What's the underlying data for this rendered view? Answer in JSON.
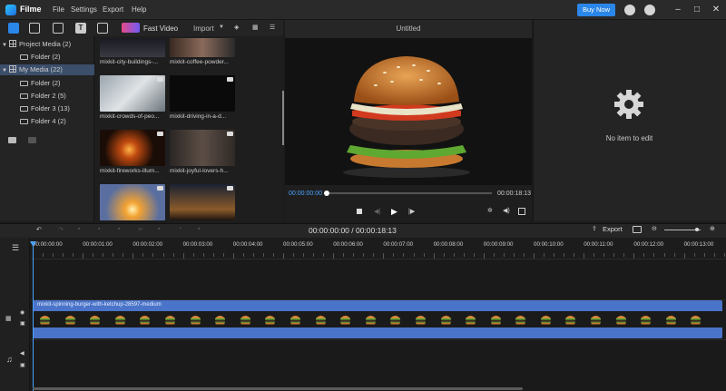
{
  "app": {
    "name": "Filme"
  },
  "menu": [
    "File",
    "Settings",
    "Export",
    "Help"
  ],
  "buy_now": "Buy Now",
  "left_toolbar": {
    "fast_video": "Fast Video",
    "import": "Import"
  },
  "tree": [
    {
      "label": "Project Media (2)",
      "level": 0,
      "selected": false
    },
    {
      "label": "Folder (2)",
      "level": 1,
      "selected": false
    },
    {
      "label": "My Media (22)",
      "level": 0,
      "selected": true
    },
    {
      "label": "Folder (2)",
      "level": 1,
      "selected": false
    },
    {
      "label": "Folder 2 (5)",
      "level": 1,
      "selected": false
    },
    {
      "label": "Folder 3 (13)",
      "level": 1,
      "selected": false
    },
    {
      "label": "Folder 4 (2)",
      "level": 1,
      "selected": false
    }
  ],
  "media": [
    {
      "label": "mixkit-city-buildings-..."
    },
    {
      "label": "mixkit-coffee-powder..."
    },
    {
      "label": "mixkit-crowds-of-peo..."
    },
    {
      "label": "mixkit-driving-in-a-d..."
    },
    {
      "label": "mixkit-fireworks-illum..."
    },
    {
      "label": "mixkit-joyful-lovers-h..."
    },
    {
      "label": ""
    },
    {
      "label": ""
    }
  ],
  "preview": {
    "title": "Untitled",
    "current_time": "00:00:00:00",
    "duration": "00:00:18:13"
  },
  "properties": {
    "empty_text": "No item to edit"
  },
  "timeline": {
    "time_display": "00:00:00:00 / 00:00:18:13",
    "export": "Export",
    "ticks": [
      "00:00:00:00",
      "00:00:01:00",
      "00:00:02:00",
      "00:00:03:00",
      "00:00:04:00",
      "00:00:05:00",
      "00:00:06:00",
      "00:00:07:00",
      "00:00:08:00",
      "00:00:09:00",
      "00:00:10:00",
      "00:00:11:00",
      "00:00:12:00",
      "00:00:13:00"
    ],
    "clip_title": "mixkit-spinning-burger-with-ketchup-28597-medium"
  },
  "colors": {
    "accent": "#2a86e8",
    "clip": "#4a74c9",
    "selection": "#3b4e6a",
    "playhead": "#4aa3ff"
  }
}
